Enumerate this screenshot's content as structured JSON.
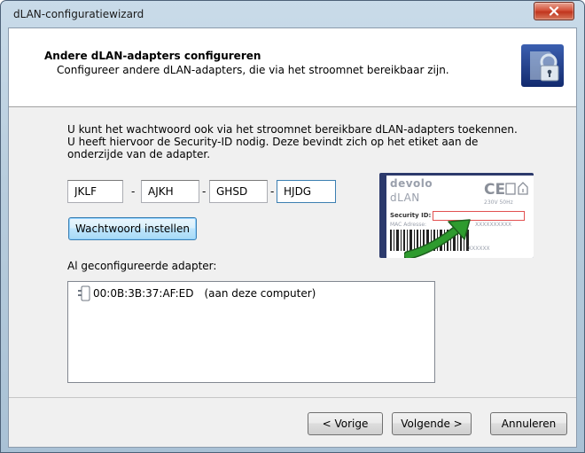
{
  "window": {
    "title": "dLAN-configuratiewizard"
  },
  "header": {
    "title": "Andere dLAN-adapters configureren",
    "subtitle": "Configureer andere dLAN-adapters, die via het stroomnet bereikbaar zijn.",
    "icon": "lock-key-icon"
  },
  "intro": {
    "lines": [
      "U kunt het wachtwoord ook via het stroomnet bereikbare dLAN-adapters toekennen.",
      "U heeft hiervoor de Security-ID nodig. Deze bevindt zich op het etiket aan de",
      "onderzijde van de adapter."
    ]
  },
  "security_id": {
    "fields": [
      "JKLF",
      "AJKH",
      "GHSD",
      "HJDG"
    ],
    "separator": "-"
  },
  "set_password_button": {
    "label": "Wachtwoord instellen"
  },
  "configured": {
    "label": "Al geconfigureerde adapter:",
    "items": [
      {
        "mac": "00:0B:3B:37:AF:ED",
        "note": "(aan deze computer)",
        "icon": "adapter-plug-icon"
      }
    ]
  },
  "label_image": {
    "brand": "devolo",
    "product": "dLAN",
    "ce": "CE",
    "voltage": "230V  50Hz",
    "security_label": "Security ID:",
    "mac_label": "MAC Adresse:",
    "mac_value": "XXXXXXXXXX",
    "bottom_code": "XXXXXX",
    "arrow_color": "#2e9b2e"
  },
  "buttons": {
    "back": "< Vorige",
    "next": "Volgende >",
    "cancel": "Annuleren"
  },
  "colors": {
    "accent_focus": "#3c7fb1",
    "close": "#c0351e"
  }
}
